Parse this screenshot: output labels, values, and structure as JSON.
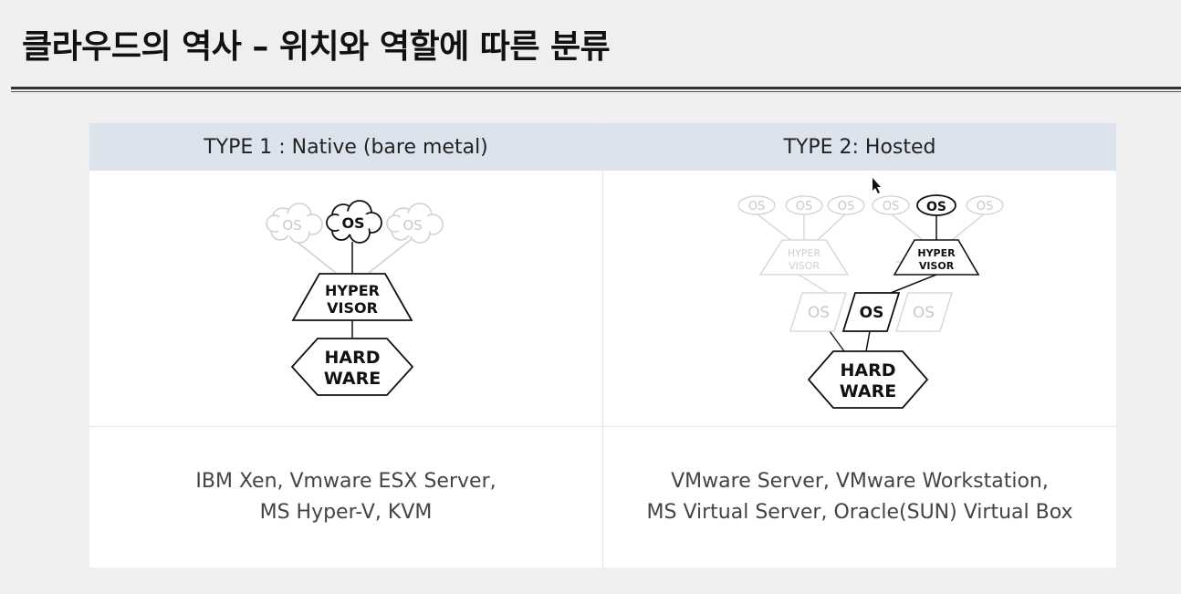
{
  "slide": {
    "title": "클라우드의 역사 – 위치와 역할에 따른 분류"
  },
  "table": {
    "type1": {
      "header": "TYPE 1 : Native (bare metal)",
      "examples_line1": "IBM Xen, Vmware ESX Server,",
      "examples_line2": "MS Hyper-V, KVM"
    },
    "type2": {
      "header": "TYPE 2: Hosted",
      "examples_line1": "VMware Server, VMware Workstation,",
      "examples_line2": "MS Virtual Server, Oracle(SUN) Virtual Box"
    }
  },
  "diagram_labels": {
    "os": "OS",
    "hyper": "HYPER",
    "visor": "VISOR",
    "hard": "HARD",
    "ware": "WARE"
  },
  "colors": {
    "header_bg": "#dde3ec",
    "active_stroke": "#111111",
    "inactive_stroke": "#cfcfcf"
  }
}
